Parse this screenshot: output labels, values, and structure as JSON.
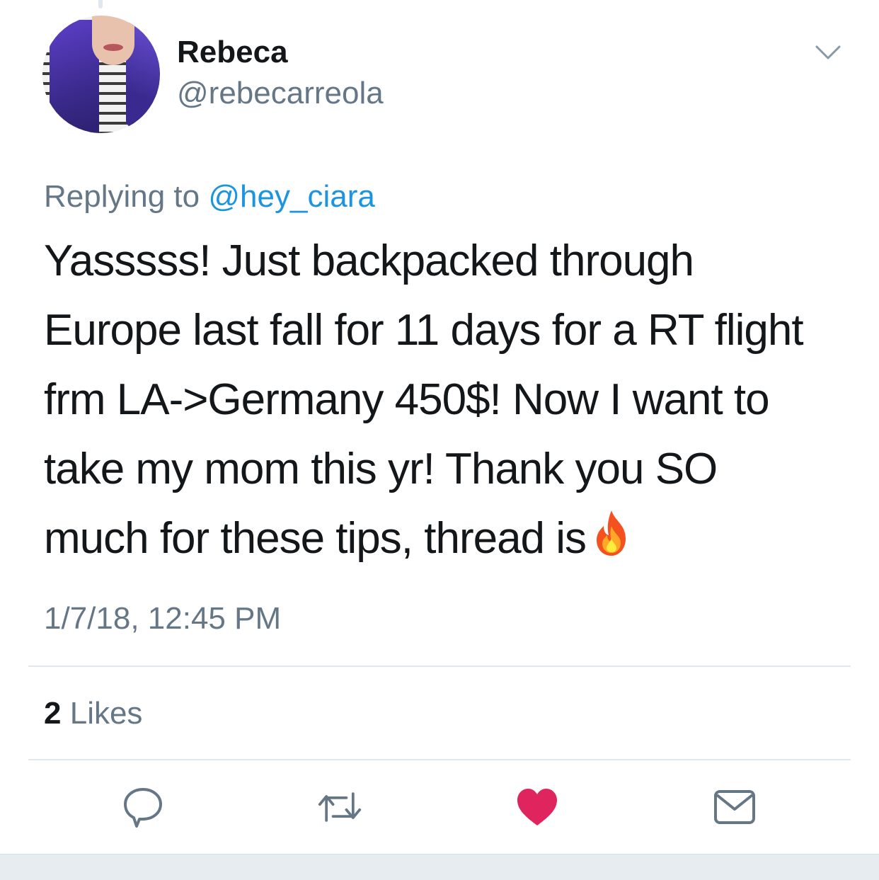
{
  "author": {
    "name": "Rebeca",
    "handle": "@rebecarreola"
  },
  "reply_context": {
    "prefix": "Replying to",
    "mention": "@hey_ciara"
  },
  "tweet": {
    "lines": [
      "Yasssss! Just backpacked through",
      "Europe last fall for 11 days for a RT flight",
      "frm LA->Germany 450$! Now I want to",
      "take my mom this yr! Thank you SO",
      "much for these tips, thread is"
    ],
    "emoji": "fire-emoji"
  },
  "timestamp": "1/7/18, 12:45 PM",
  "stats": {
    "likes_count": "2",
    "likes_label": "Likes"
  },
  "actions": [
    "reply-icon",
    "retweet-icon",
    "like-icon",
    "direct-message-icon"
  ],
  "colors": {
    "secondary_text": "#657786",
    "link": "#1b95e0",
    "like_active": "#e0245e",
    "icon": "#657786"
  }
}
